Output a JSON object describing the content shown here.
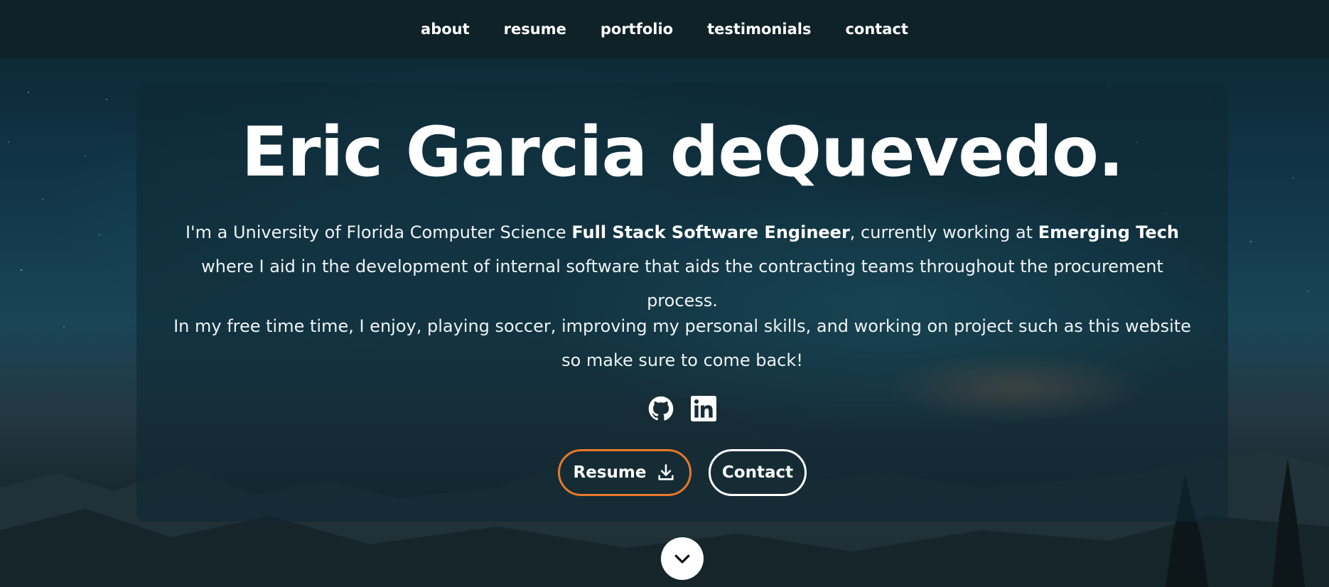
{
  "nav": {
    "items": [
      "about",
      "resume",
      "portfolio",
      "testimonials",
      "contact"
    ]
  },
  "hero": {
    "title": "Eric Garcia deQuevedo.",
    "intro": {
      "part1": "I'm a University of Florida Computer Science ",
      "role": "Full Stack Software Engineer",
      "part2": ", currently working at ",
      "company": "Emerging Tech",
      "part3": " where I aid in the development of internal software that aids the contracting teams throughout the procurement process."
    },
    "hobbies": "In my free time time, I enjoy, playing soccer, improving my personal skills, and working on project such as this website so make sure to come back!",
    "socials": [
      {
        "icon": "github-icon"
      },
      {
        "icon": "linkedin-icon"
      }
    ],
    "buttons": {
      "resume_label": "Resume",
      "contact_label": "Contact"
    }
  },
  "colors": {
    "accent": "#e8782a",
    "nav_bg": "#0e2228",
    "card_bg": "rgba(15,40,52,0.62)"
  }
}
